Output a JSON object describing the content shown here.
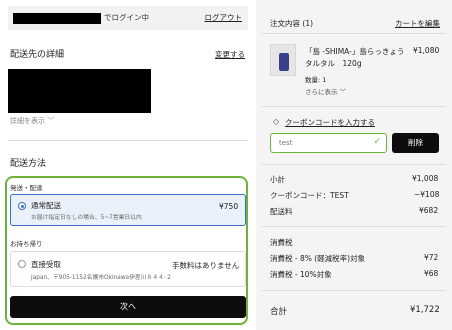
{
  "header": {
    "login_suffix": "でログイン中",
    "logout": "ログアウト"
  },
  "address": {
    "title": "配送先の詳細",
    "change": "変更する",
    "show_details": "詳細を表示 ﹀"
  },
  "shipping": {
    "title": "配送方法",
    "group_delivery": "発送・配達",
    "standard": {
      "name": "通常配送",
      "note": "お届け指定日なしの場合、5~7営業日以内",
      "price": "¥750"
    },
    "group_pickup": "お持ち帰り",
    "pickup": {
      "name": "直接受取",
      "note": "Japan、〒905-1152名護市Okinawa伊差川８４４-２",
      "price": "手数料はありません"
    },
    "next": "次へ"
  },
  "order": {
    "title": "注文内容",
    "count": "(1)",
    "edit_cart": "カートを編集",
    "item": {
      "name_line1": "「島 -SHIMA-」島らっきょう",
      "name_line2": "タルタル　120g",
      "price": "¥1,080",
      "qty": "数量: 1",
      "more": "さらに表示 ﹀"
    },
    "coupon_link": "クーポンコードを入力する",
    "coupon_value": "test",
    "delete": "削除",
    "lines": [
      {
        "label": "小計",
        "value": "¥1,008"
      },
      {
        "label": "クーポンコード：TEST",
        "value": "−¥108"
      },
      {
        "label": "配送料",
        "value": "¥682"
      }
    ],
    "tax_title": "消費税",
    "tax_lines": [
      {
        "label": "消費税 - 8% (軽減税率)対象",
        "value": "¥72"
      },
      {
        "label": "消費税 - 10%対象",
        "value": "¥68"
      }
    ],
    "total_label": "合計",
    "total_value": "¥1,722"
  },
  "icons": {
    "tag": "tag-icon",
    "check": "check-icon",
    "radio": "radio-icon"
  },
  "colors": {
    "accent_green": "#6cb33e",
    "select_blue": "#3b6fc9",
    "button": "#0d0d0d"
  }
}
